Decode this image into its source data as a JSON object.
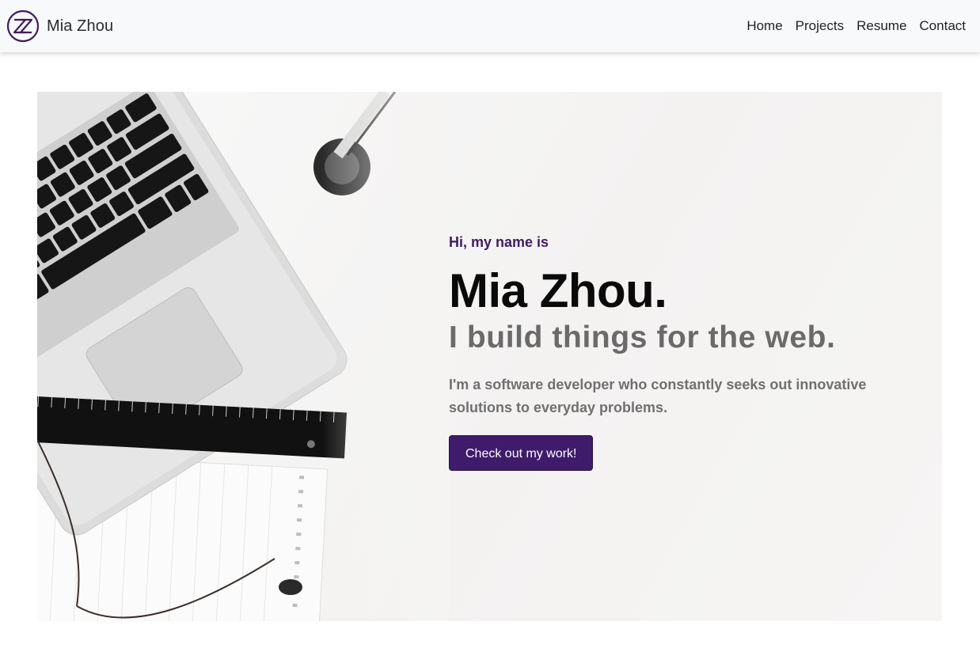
{
  "navbar": {
    "brand_name": "Mia Zhou",
    "logo_icon": "zz-monogram-icon",
    "links": [
      {
        "label": "Home"
      },
      {
        "label": "Projects"
      },
      {
        "label": "Resume"
      },
      {
        "label": "Contact"
      }
    ]
  },
  "hero": {
    "greeting": "Hi, my name is",
    "name": "Mia Zhou.",
    "tagline": "I build things for the web.",
    "description": "I'm a software developer who constantly seeks out innovative solutions to everyday problems.",
    "cta_label": "Check out my work!",
    "image_icon": "desk-flatlay-laptop-image"
  },
  "colors": {
    "accent": "#3e1b6b",
    "navbar_bg": "#f8f9fa",
    "hero_bg": "#f4f3f2"
  }
}
